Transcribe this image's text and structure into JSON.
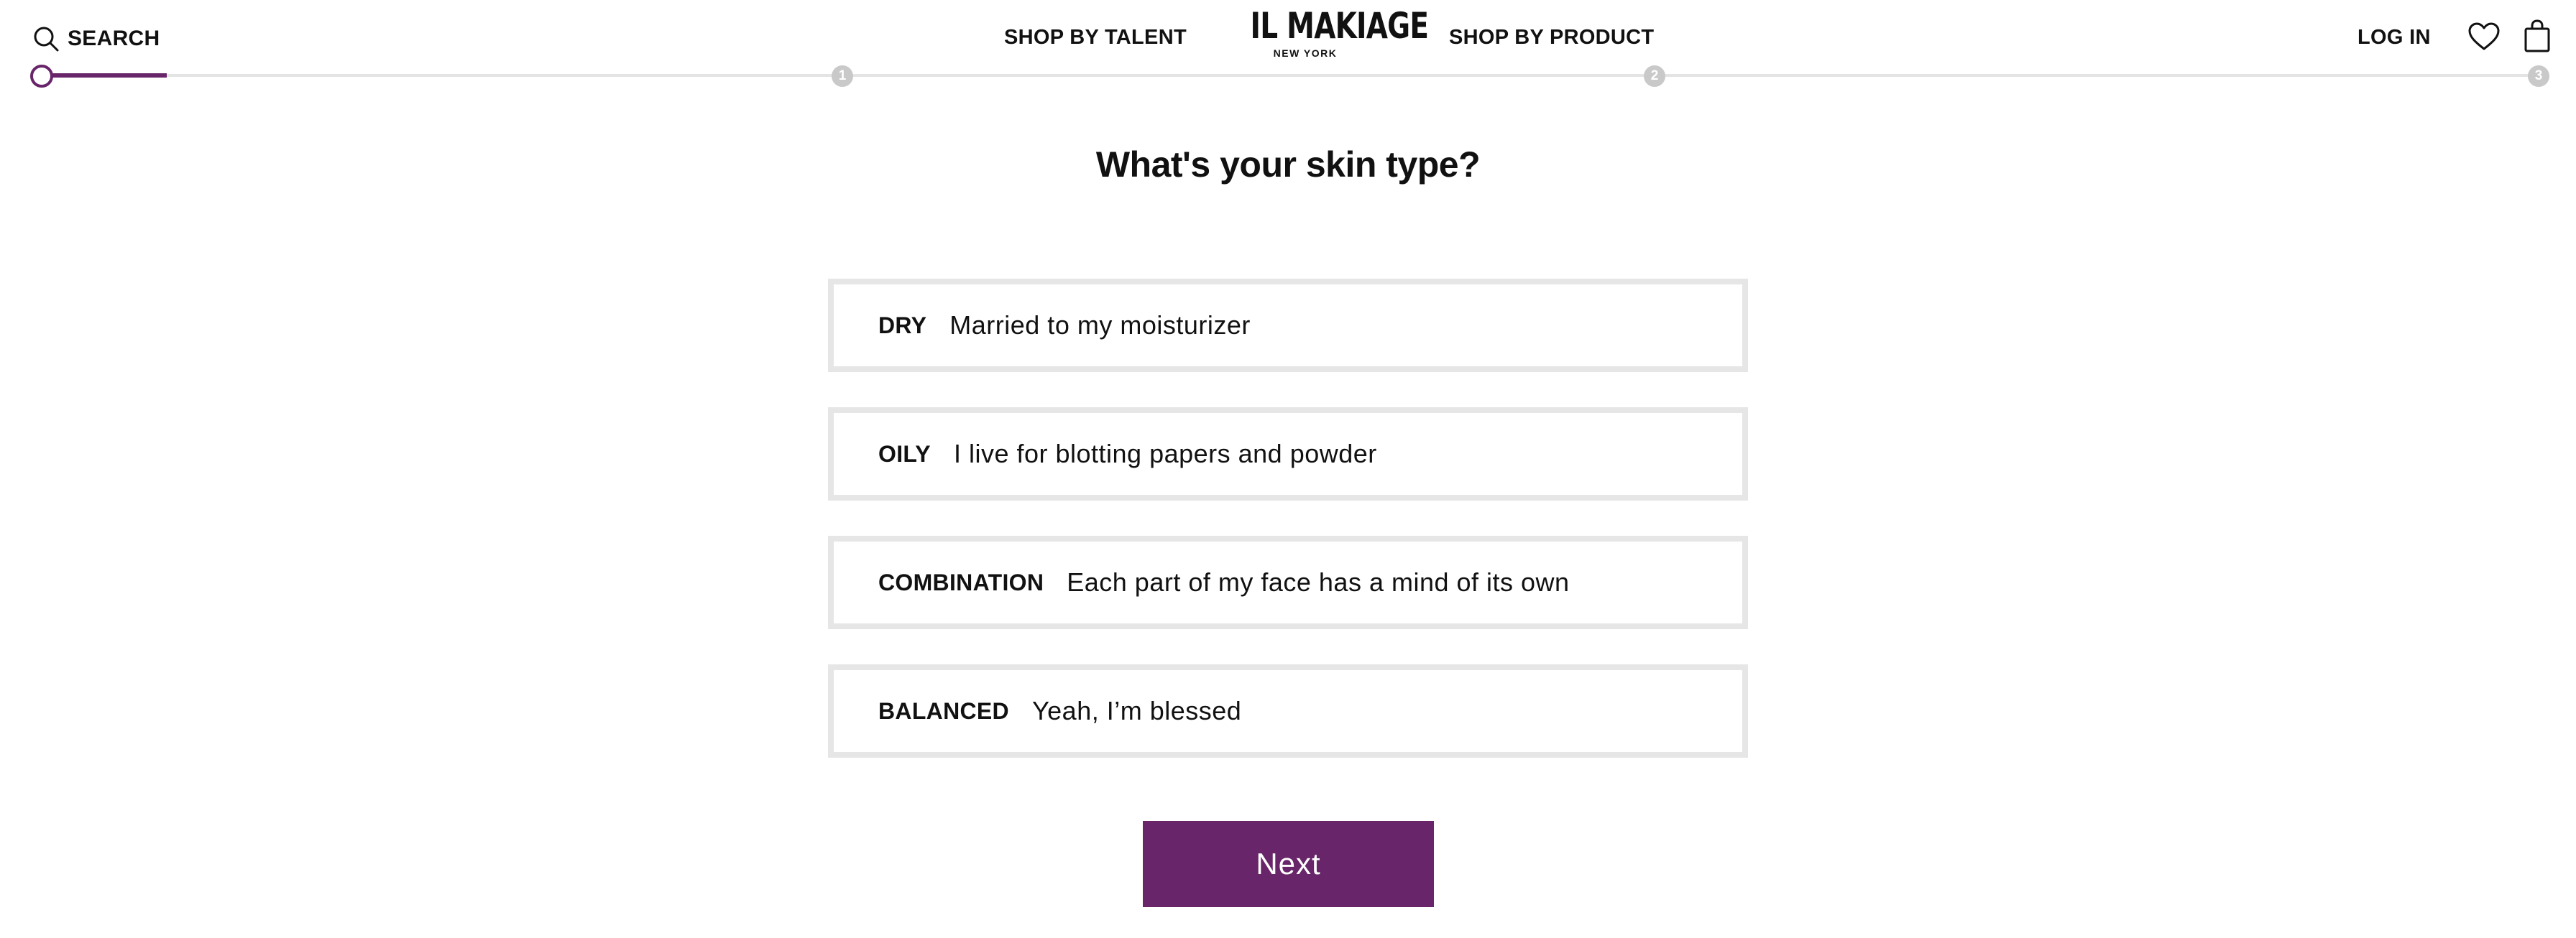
{
  "header": {
    "search_label": "SEARCH",
    "nav": {
      "shop_by_talent": "SHOP BY TALENT",
      "shop_by_product": "SHOP BY PRODUCT"
    },
    "logo": {
      "name": "IL MAKIAGE",
      "tagline": "NEW YORK"
    },
    "login_label": "LOG IN",
    "icons": [
      "search-icon",
      "heart-icon",
      "shopping-bag-icon"
    ]
  },
  "progress": {
    "current_fraction": 0.05,
    "steps": [
      "1",
      "2",
      "3"
    ]
  },
  "question": {
    "title": "What's your skin type?",
    "options": [
      {
        "type": "DRY",
        "description": "Married to my moisturizer"
      },
      {
        "type": "OILY",
        "description": "I live for blotting papers and powder"
      },
      {
        "type": "COMBINATION",
        "description": "Each part of my face has a mind of its own"
      },
      {
        "type": "BALANCED",
        "description": "Yeah, I’m blessed"
      }
    ]
  },
  "actions": {
    "next_label": "Next"
  },
  "colors": {
    "accent": "#682569",
    "option_border": "#e6e6e6",
    "track": "#e4e4e4",
    "step_dot": "#c9c9c9"
  }
}
